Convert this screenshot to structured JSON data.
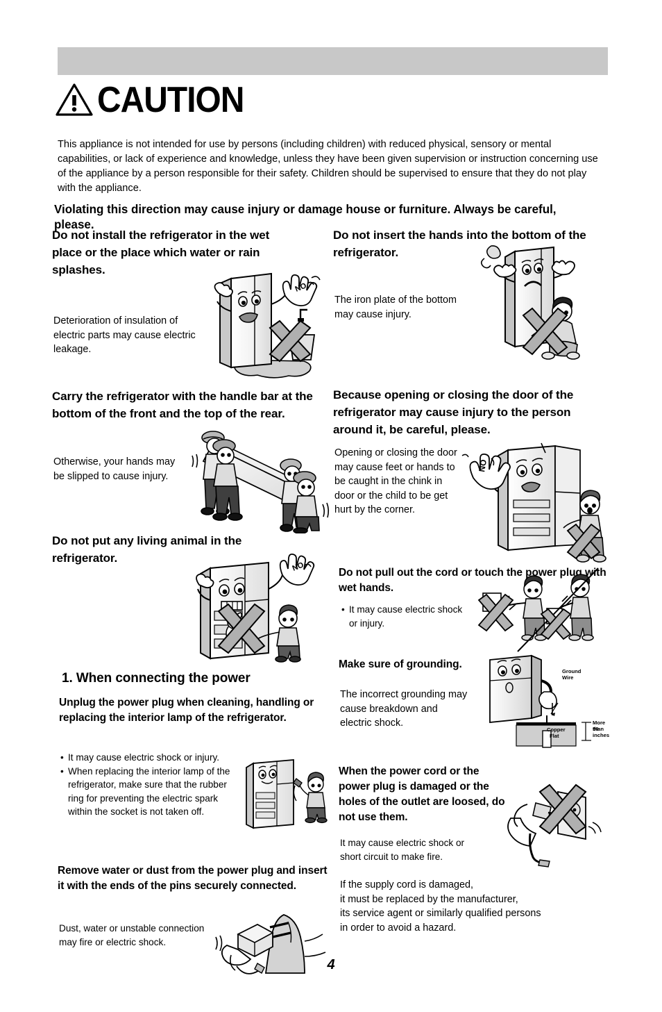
{
  "document": {
    "page_number": "4",
    "header_band_color": "#c8c8c8"
  },
  "caution": {
    "icon": "warning-triangle-icon",
    "title": "CAUTION",
    "intro": "This appliance is not intended for use by persons (including children) with reduced physical, sensory or mental capabilities, or lack of experience and knowledge, unless they have been given supervision or instruction concerning use of the appliance by a person responsible for their safety. Children should be supervised to ensure that they do not play with the appliance.",
    "violating_line": "Violating this direction may cause injury or damage house or furniture. Always be careful, please."
  },
  "left_column": {
    "sections": [
      {
        "heading": "Do not install the refrigerator in the wet place or the place which water or rain splashes.",
        "body": "Deterioration of insulation of electric parts may cause electric leakage.",
        "illustration": "refrigerator-wet-place-no-sign"
      },
      {
        "heading": "Carry the refrigerator with the handle bar at the bottom of the front and the top of the rear.",
        "body": "Otherwise, your hands may be slipped to cause injury.",
        "illustration": "four-workers-carrying-refrigerator"
      },
      {
        "heading": "Do not put any living animal in the refrigerator.",
        "illustration": "refrigerator-dog-crossed-out"
      },
      {
        "heading": "1. When connecting the power",
        "is_numbered": true
      },
      {
        "heading": "Unplug the power plug when cleaning, handling or replacing the interior lamp of the refrigerator.",
        "bullets": [
          "It may cause electric shock or injury.",
          "When replacing the interior lamp of the refrigerator, make sure that the rubber ring for preventing the electric spark within the socket is not taken off."
        ],
        "illustration": "refrigerator-interior-lamp-child"
      },
      {
        "heading": "Remove water or dust from the power plug and insert it with the ends of the pins securely connected.",
        "body": "Dust, water or unstable connection may fire or electric shock.",
        "illustration": "power-plug-and-cloth"
      }
    ]
  },
  "right_column": {
    "sections": [
      {
        "heading": "Do not insert the hands into the bottom of the refrigerator.",
        "body": "The iron plate of the bottom may cause injury.",
        "illustration": "child-hand-under-refrigerator-crossed-out"
      },
      {
        "heading": "Because opening or closing the door of the refrigerator may cause injury to the person around it, be careful, please.",
        "body": "Opening or closing the door may cause feet or hands to be caught in the chink in door or the child to be get hurt by the corner.",
        "illustration": "refrigerator-open-door-child-no-sign"
      },
      {
        "heading": "Do not pull out the cord or touch the power plug with wet hands.",
        "bullets": [
          "It may cause electric shock or injury."
        ],
        "illustration": "wet-hands-plug-crossed-out"
      },
      {
        "heading": "Make sure of grounding.",
        "body": "The incorrect grounding may cause breakdown and electric shock.",
        "illustration": "grounding-diagram",
        "diagram_labels": {
          "ground_wire": "Ground\nWire",
          "ground_wire_line1": "Ground",
          "ground_wire_line2": "Wire",
          "copper_line1": "Copper",
          "copper_line2": "Flat",
          "depth_line1": "More than",
          "depth_line2": "30 inches"
        }
      },
      {
        "heading": "When the power cord or the power plug is damaged or the holes of the outlet are loosed, do not use them.",
        "body": "It may cause electric shock or short circuit to make fire.",
        "illustration": "damaged-outlet-crossed-out"
      },
      {
        "body": "If the supply cord is damaged,\nit must be replaced by the manufacturer,\nits service agent or similarly qualified persons\nin order to avoid a hazard.",
        "is_plain": true
      }
    ]
  }
}
